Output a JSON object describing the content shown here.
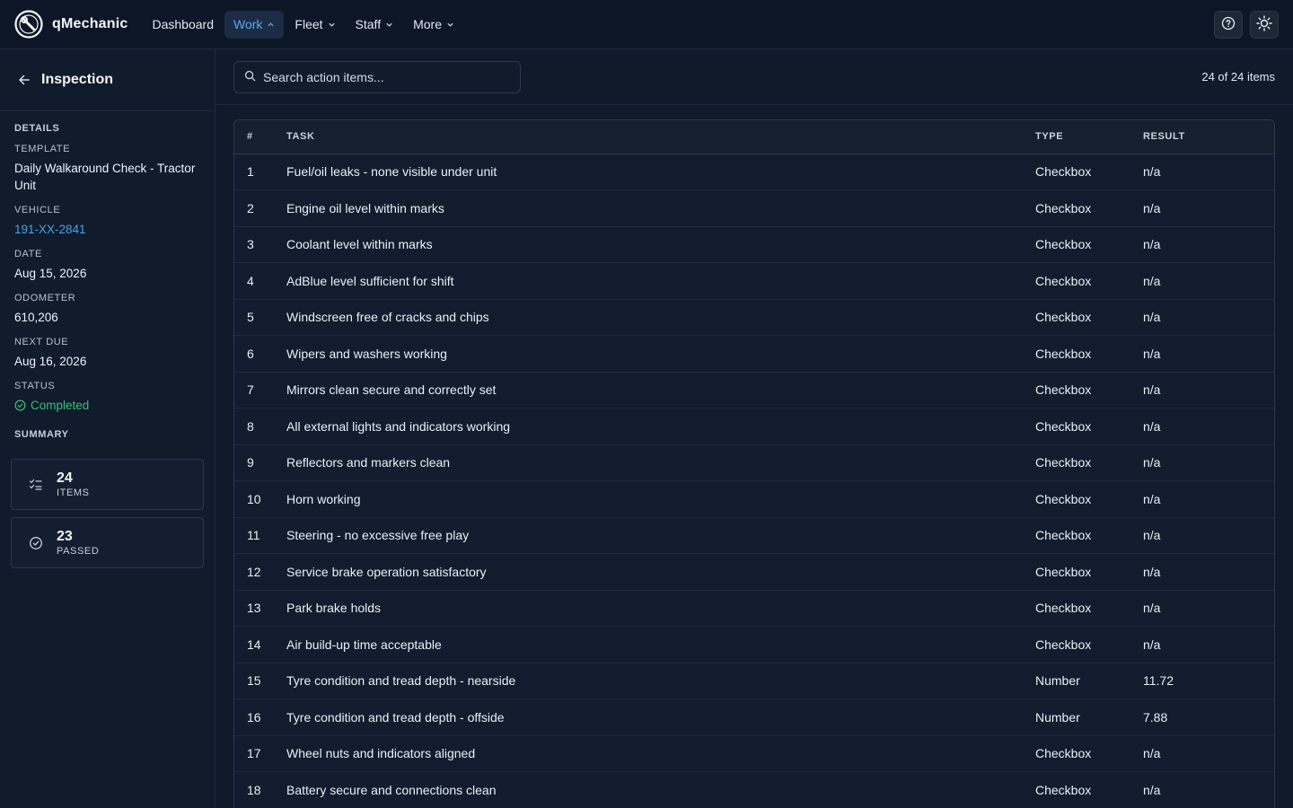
{
  "app": {
    "name": "qMechanic"
  },
  "nav": {
    "items": [
      {
        "label": "Dashboard",
        "has_menu": false,
        "active": false
      },
      {
        "label": "Work",
        "has_menu": true,
        "active": true
      },
      {
        "label": "Fleet",
        "has_menu": true,
        "active": false
      },
      {
        "label": "Staff",
        "has_menu": true,
        "active": false
      },
      {
        "label": "More",
        "has_menu": true,
        "active": false
      }
    ],
    "right_icons": [
      "help-icon",
      "sun-icon"
    ]
  },
  "sidebar": {
    "title": "Inspection",
    "details_label": "DETAILS",
    "template": {
      "label": "TEMPLATE",
      "value": "Daily Walkaround Check - Tractor Unit"
    },
    "vehicle": {
      "label": "VEHICLE",
      "value": "191-XX-2841"
    },
    "date": {
      "label": "DATE",
      "value": "Aug 15, 2026"
    },
    "odometer": {
      "label": "ODOMETER",
      "value": "610,206"
    },
    "next_due": {
      "label": "NEXT DUE",
      "value": "Aug 16, 2026"
    },
    "status": {
      "label": "STATUS",
      "value": "Completed"
    },
    "summary_label": "SUMMARY",
    "summary_cards": [
      {
        "icon": "list-check-icon",
        "value": "24",
        "label": "ITEMS"
      },
      {
        "icon": "circle-check-icon",
        "value": "23",
        "label": "PASSED"
      }
    ]
  },
  "toolbar": {
    "search_placeholder": "Search action items...",
    "count_text": "24 of 24 items"
  },
  "table": {
    "columns": [
      "#",
      "TASK",
      "TYPE",
      "RESULT"
    ],
    "rows": [
      {
        "num": "1",
        "task": "Fuel/oil leaks - none visible under unit",
        "type": "Checkbox",
        "result": "n/a"
      },
      {
        "num": "2",
        "task": "Engine oil level within marks",
        "type": "Checkbox",
        "result": "n/a"
      },
      {
        "num": "3",
        "task": "Coolant level within marks",
        "type": "Checkbox",
        "result": "n/a"
      },
      {
        "num": "4",
        "task": "AdBlue level sufficient for shift",
        "type": "Checkbox",
        "result": "n/a"
      },
      {
        "num": "5",
        "task": "Windscreen free of cracks and chips",
        "type": "Checkbox",
        "result": "n/a"
      },
      {
        "num": "6",
        "task": "Wipers and washers working",
        "type": "Checkbox",
        "result": "n/a"
      },
      {
        "num": "7",
        "task": "Mirrors clean secure and correctly set",
        "type": "Checkbox",
        "result": "n/a"
      },
      {
        "num": "8",
        "task": "All external lights and indicators working",
        "type": "Checkbox",
        "result": "n/a"
      },
      {
        "num": "9",
        "task": "Reflectors and markers clean",
        "type": "Checkbox",
        "result": "n/a"
      },
      {
        "num": "10",
        "task": "Horn working",
        "type": "Checkbox",
        "result": "n/a"
      },
      {
        "num": "11",
        "task": "Steering - no excessive free play",
        "type": "Checkbox",
        "result": "n/a"
      },
      {
        "num": "12",
        "task": "Service brake operation satisfactory",
        "type": "Checkbox",
        "result": "n/a"
      },
      {
        "num": "13",
        "task": "Park brake holds",
        "type": "Checkbox",
        "result": "n/a"
      },
      {
        "num": "14",
        "task": "Air build-up time acceptable",
        "type": "Checkbox",
        "result": "n/a"
      },
      {
        "num": "15",
        "task": "Tyre condition and tread depth - nearside",
        "type": "Number",
        "result": "11.72"
      },
      {
        "num": "16",
        "task": "Tyre condition and tread depth - offside",
        "type": "Number",
        "result": "7.88"
      },
      {
        "num": "17",
        "task": "Wheel nuts and indicators aligned",
        "type": "Checkbox",
        "result": "n/a"
      },
      {
        "num": "18",
        "task": "Battery secure and connections clean",
        "type": "Checkbox",
        "result": "n/a"
      }
    ]
  }
}
